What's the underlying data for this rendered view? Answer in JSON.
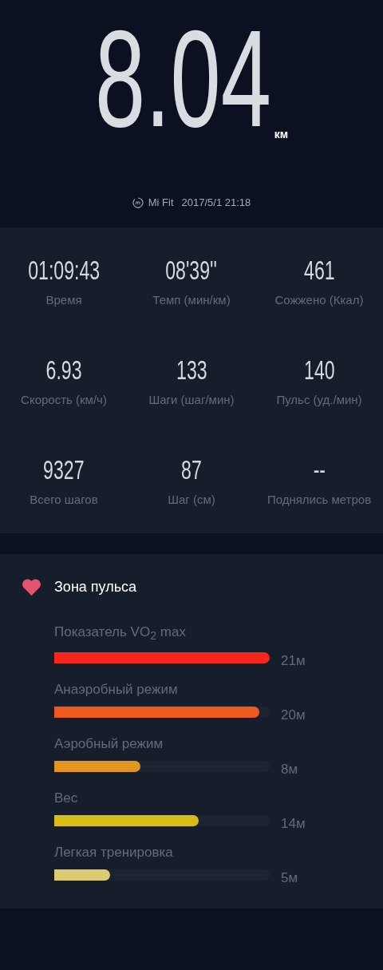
{
  "distance": {
    "value": "8.04",
    "unit": "км"
  },
  "source": {
    "app": "Mi Fit",
    "datetime": "2017/5/1 21:18"
  },
  "stats": [
    {
      "value": "01:09:43",
      "label": "Время"
    },
    {
      "value": "08'39''",
      "label": "Темп (мин/км)"
    },
    {
      "value": "461",
      "label": "Сожжено (Ккал)"
    },
    {
      "value": "6.93",
      "label": "Скорость (км/ч)"
    },
    {
      "value": "133",
      "label": "Шаги (шаг/мин)"
    },
    {
      "value": "140",
      "label": "Пульс (уд./мин)"
    },
    {
      "value": "9327",
      "label": "Всего шагов"
    },
    {
      "value": "87",
      "label": "Шаг (см)"
    },
    {
      "value": "--",
      "label": "Поднялись метров"
    }
  ],
  "heart_zone": {
    "title": "Зона пульса",
    "zones": [
      {
        "name": "Показатель VO$_{2}$ max",
        "level": 1.0,
        "color": "#f5261c",
        "reading": "21м"
      },
      {
        "name": "Анаэробный режим",
        "level": 0.95,
        "color": "#ee5a1e",
        "reading": "20м"
      },
      {
        "name": "Аэробный режим",
        "level": 0.4,
        "color": "#e3961f",
        "reading": "8м"
      },
      {
        "name": "Вес",
        "level": 0.67,
        "color": "#d6bd18",
        "reading": "14м"
      },
      {
        "name": "Легкая тренировка",
        "level": 0.26,
        "color": "#dccb72",
        "reading": "5м"
      }
    ]
  }
}
